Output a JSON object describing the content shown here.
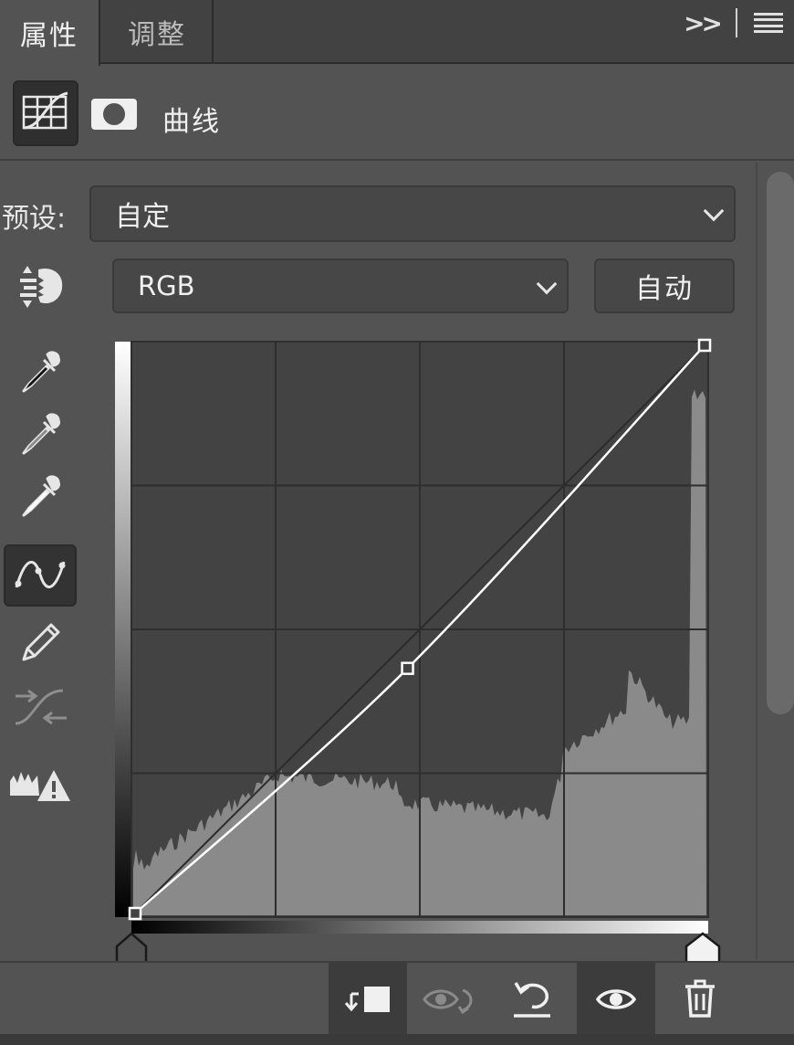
{
  "tabs": [
    {
      "label": "属性",
      "active": true
    },
    {
      "label": "调整",
      "active": false
    }
  ],
  "header": {
    "title": "曲线"
  },
  "preset": {
    "label": "预设:",
    "value": "自定"
  },
  "channel": {
    "value": "RGB"
  },
  "auto_button": {
    "label": "自动"
  },
  "tools": [
    "sample-black-eyedropper-icon",
    "sample-gray-eyedropper-icon",
    "sample-white-eyedropper-icon",
    "curve-point-tool-icon",
    "pencil-icon",
    "smooth-curve-icon",
    "clipping-warning-icon"
  ],
  "active_tool": "curve-point-tool-icon",
  "curve": {
    "points": [
      [
        0,
        0
      ],
      [
        122,
        110
      ],
      [
        255,
        255
      ]
    ],
    "range": [
      0,
      255
    ]
  },
  "bottom_buttons": [
    "clip-to-layer-icon",
    "view-previous-state-icon",
    "reset-icon",
    "visibility-eye-icon",
    "trash-icon"
  ],
  "colors": {
    "panel": "#535353",
    "tabbar": "#424242",
    "graph_bg": "#434343",
    "histogram": "#8a8a8a",
    "curve": "#ffffff"
  }
}
